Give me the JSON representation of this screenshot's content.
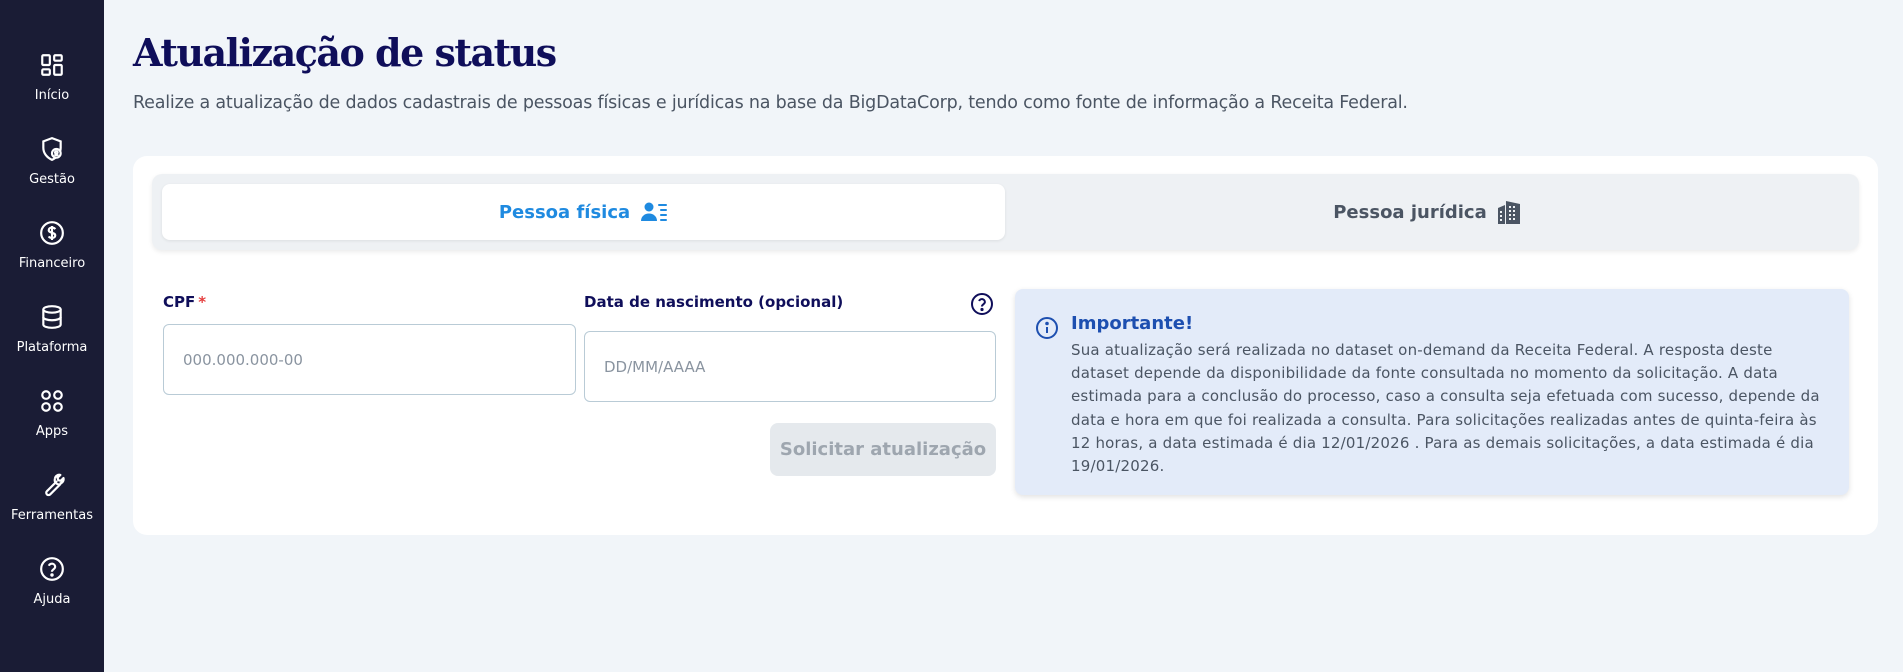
{
  "sidebar": {
    "items": [
      {
        "label": "Início",
        "icon": "dashboard-icon"
      },
      {
        "label": "Gestão",
        "icon": "shield-user-icon"
      },
      {
        "label": "Financeiro",
        "icon": "dollar-icon"
      },
      {
        "label": "Plataforma",
        "icon": "database-icon"
      },
      {
        "label": "Apps",
        "icon": "apps-grid-icon"
      },
      {
        "label": "Ferramentas",
        "icon": "wrench-icon"
      },
      {
        "label": "Ajuda",
        "icon": "help-icon"
      }
    ]
  },
  "header": {
    "title": "Atualização de status",
    "subtitle": "Realize a atualização de dados cadastrais de pessoas físicas e jurídicas na base da BigDataCorp, tendo como fonte de informação a Receita Federal."
  },
  "tabs": {
    "pessoa_fisica": "Pessoa física",
    "pessoa_juridica": "Pessoa jurídica"
  },
  "form": {
    "cpf_label": "CPF",
    "required_mark": "*",
    "cpf_placeholder": "000.000.000-00",
    "cpf_value": "",
    "birth_label": "Data de nascimento (opcional)",
    "birth_placeholder": "DD/MM/AAAA",
    "birth_value": "",
    "submit_label": "Solicitar atualização"
  },
  "info": {
    "title": "Importante!",
    "text": "Sua atualização será realizada no dataset on-demand da Receita Federal. A resposta deste dataset depende da disponibilidade da fonte consultada no momento da solicitação. A data estimada para a conclusão do processo, caso a consulta seja efetuada com sucesso, depende da data e hora em que foi realizada a consulta. Para solicitações realizadas antes de quinta-feira às 12 horas, a data estimada é dia 12/01/2026 . Para as demais solicitações, a data estimada é dia 19/01/2026."
  },
  "colors": {
    "sidebar_bg": "#1a1c35",
    "title": "#0f0e5a",
    "active_tab": "#1f8ae0",
    "info_bg": "#e3ebf9",
    "required": "#e53e3e"
  }
}
